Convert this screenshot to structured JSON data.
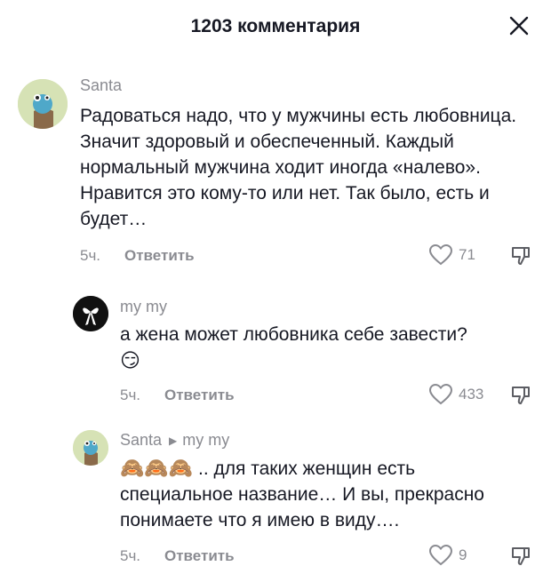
{
  "header": {
    "title": "1203 комментария",
    "close_icon": "close-icon"
  },
  "comments": [
    {
      "username": "Santa",
      "text": "Радоваться надо, что у мужчины есть любовница. Значит здоровый и обеспеченный. Каждый нормальный мужчина ходит иногда «налево». Нравится это кому-то или нет. Так было, есть и будет…",
      "time": "5ч.",
      "reply_label": "Ответить",
      "likes": "71"
    },
    {
      "username": "my my",
      "text": "а жена может любовника себе завести?",
      "emoji": "😏",
      "time": "5ч.",
      "reply_label": "Ответить",
      "likes": "433"
    },
    {
      "username": "Santa",
      "reply_to": "my my",
      "emoji": "🙈🙈🙈",
      "text": ".. для таких женщин есть специальное название… И вы, прекрасно понимаете что я имею в виду….",
      "time": "5ч.",
      "reply_label": "Ответить",
      "likes": "9"
    }
  ],
  "colors": {
    "text": "#161823",
    "secondary": "#8a8b91",
    "avatar_bg": "#d6e2b5"
  }
}
